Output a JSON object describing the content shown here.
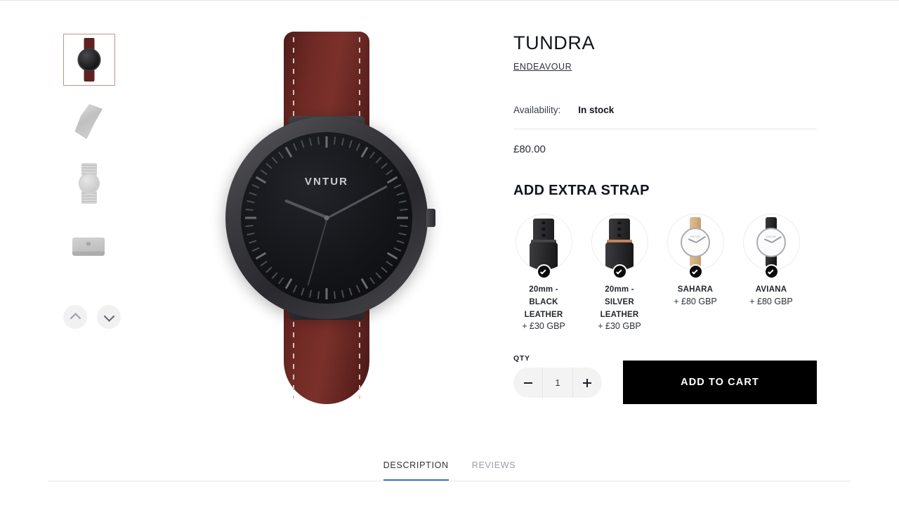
{
  "product": {
    "title": "TUNDRA",
    "vendor": "ENDEAVOUR",
    "availability_label": "Availability:",
    "availability_value": "In stock",
    "price": "£80.00"
  },
  "straps": {
    "heading": "ADD EXTRA STRAP",
    "options": [
      {
        "name": "20mm - BLACK LEATHER",
        "price": "+ £30 GBP",
        "art": "coil-black"
      },
      {
        "name": "20mm - SILVER LEATHER",
        "price": "+ £30 GBP",
        "art": "coil-rose"
      },
      {
        "name": "SAHARA",
        "price": "+ £80 GBP",
        "art": "watch-tan"
      },
      {
        "name": "AVIANA",
        "price": "+ £80 GBP",
        "art": "watch-black"
      }
    ]
  },
  "buy": {
    "qty_label": "QTY",
    "qty_value": "1",
    "decrease_label": "minus-icon",
    "increase_label": "plus-icon",
    "add_to_cart": "ADD TO CART"
  },
  "gallery": {
    "brand_on_dial": "VNTUR",
    "thumbnails": [
      {
        "alt": "watch-front-burgundy",
        "active": true
      },
      {
        "alt": "watch-angled-mesh",
        "active": false
      },
      {
        "alt": "watch-mesh-band",
        "active": false
      },
      {
        "alt": "presentation-box",
        "active": false
      }
    ],
    "prev_label": "chevron-up-icon",
    "next_label": "chevron-down-icon"
  },
  "tabs": [
    {
      "label": "DESCRIPTION",
      "active": true
    },
    {
      "label": "REVIEWS",
      "active": false
    }
  ],
  "colors": {
    "strap_burgundy": "#6b2420",
    "accent_tab": "#3b6fd4",
    "thumb_active_border": "#c4908f",
    "cart_button": "#000000"
  }
}
